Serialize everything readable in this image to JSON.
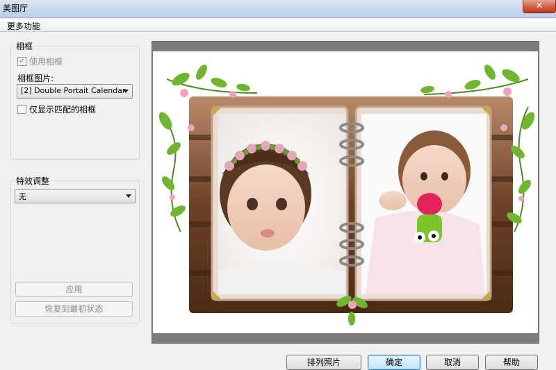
{
  "window": {
    "title": "美图厅",
    "close_glyph": "✕"
  },
  "menu": {
    "section_label": "更多功能"
  },
  "frame_group": {
    "title": "相框",
    "use_frame_label": "使用相框",
    "use_frame_checked": true,
    "frame_image_label": "相框图片:",
    "frame_image_value": "[2] Double Portait Calendar",
    "only_matching_label": "仅显示匹配的相框",
    "only_matching_checked": false
  },
  "effect_group": {
    "title": "特效调整",
    "effect_value": "无",
    "apply_label": "应用",
    "restore_label": "恢复到最初状态"
  },
  "bottom_buttons": {
    "arrange_label": "排列照片",
    "ok_label": "确定",
    "cancel_label": "取消",
    "help_label": "帮助"
  },
  "colors": {
    "frame_brown": "#5a3520",
    "frame_brown_light": "#8b5a3c",
    "leaf_green": "#5ea62a",
    "flower_pink": "#e88aa8"
  }
}
